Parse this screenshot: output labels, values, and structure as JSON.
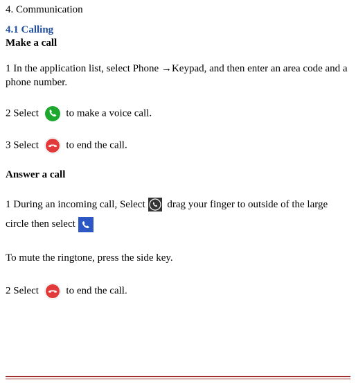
{
  "section": {
    "number_title": "4. Communication",
    "sub_number_title": "4.1 Calling",
    "make_call_label": "Make a call",
    "step1": "1 In the application list, select Phone →Keypad, and then enter an area code and a phone number.",
    "step2_a": "2 Select ",
    "step2_b": " to make a voice call.",
    "step3_a": "3 Select ",
    "step3_b": " to end the call.",
    "answer_label": "Answer a call",
    "ans1_a": "1 During an incoming call, Select",
    "ans1_b": " drag your finger to outside of the large circle then select",
    "mute": "To mute the ringtone, press the side key.",
    "ans2_a": "2 Select ",
    "ans2_b": " to end the call."
  },
  "icons": {
    "dial": "dial-green-icon",
    "end": "end-red-icon",
    "incoming": "incoming-icon",
    "answer": "answer-square-icon"
  }
}
